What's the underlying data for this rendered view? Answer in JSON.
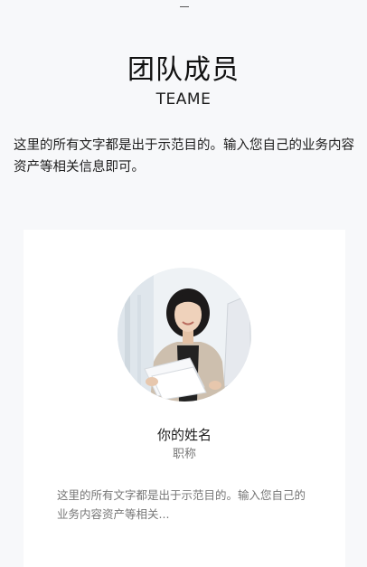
{
  "section": {
    "title": "团队成员",
    "subtitle": "TEAME",
    "intro": "这里的所有文字都是出于示范目的。输入您自己的业务内容资产等相关信息即可。"
  },
  "member": {
    "photo_icon": "person-photo",
    "name": "你的姓名",
    "role": "职称",
    "description": "这里的所有文字都是出于示范目的。输入您自己的业务内容资产等相关..."
  }
}
